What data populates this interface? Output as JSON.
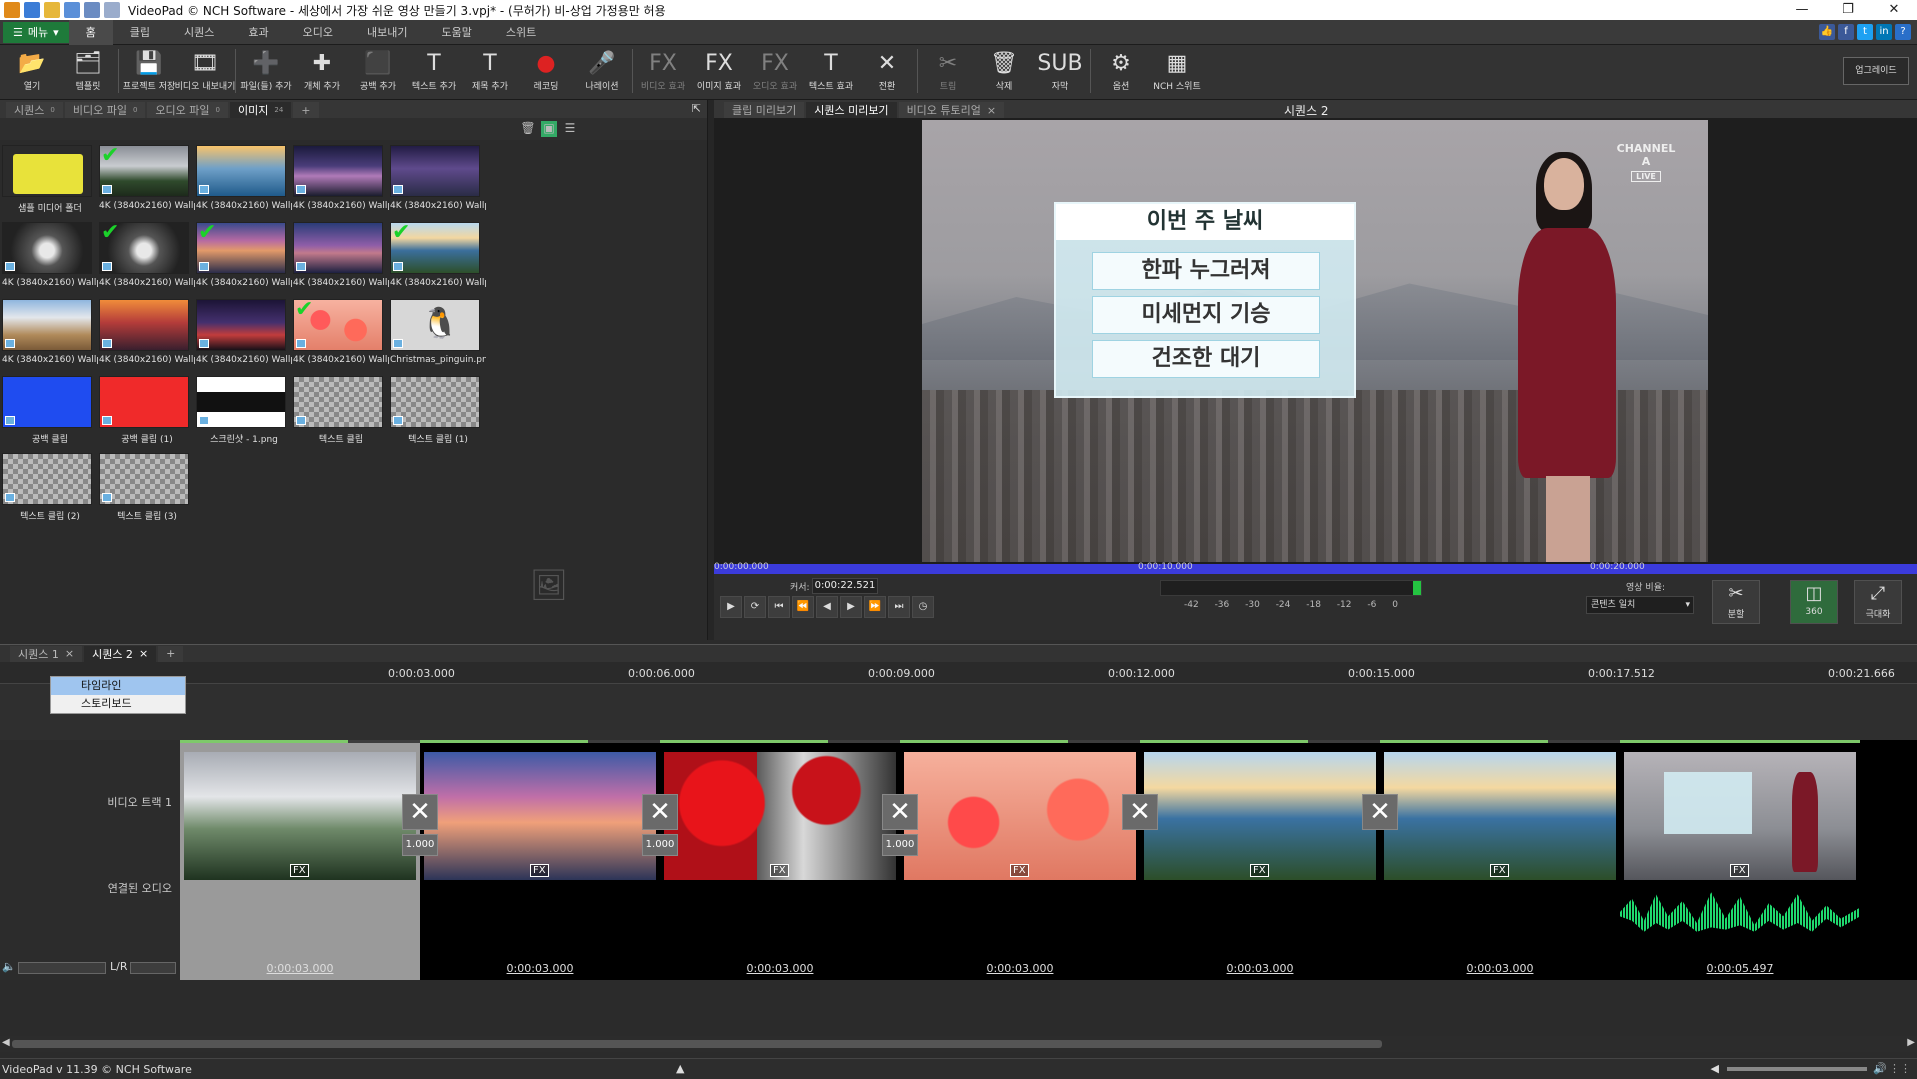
{
  "window": {
    "title": "VideoPad © NCH Software - 세상에서 가장 쉬운 영상 만들기 3.vpj* - (무허가) 비-상업 가정용만 허용",
    "controls": [
      "—",
      "❐",
      "✕"
    ]
  },
  "menu": {
    "menu_button": "메뉴",
    "tabs": [
      "홈",
      "클립",
      "시퀀스",
      "효과",
      "오디오",
      "내보내기",
      "도움말",
      "스위트"
    ],
    "active_tab": "홈"
  },
  "ribbon": {
    "buttons": [
      {
        "label": "열기",
        "icon": "folder-open-icon",
        "glyph": "📂"
      },
      {
        "label": "템플릿",
        "icon": "template-icon",
        "glyph": "🗂"
      },
      {
        "label": "프로젝트 저장",
        "icon": "save-icon",
        "glyph": "💾"
      },
      {
        "label": "비디오 내보내기",
        "icon": "export-icon",
        "glyph": "🎞"
      },
      {
        "label": "파일(들) 추가",
        "icon": "add-files-icon",
        "glyph": "➕"
      },
      {
        "label": "개체 추가",
        "icon": "add-object-icon",
        "glyph": "✚"
      },
      {
        "label": "공백 추가",
        "icon": "add-blank-icon",
        "glyph": "⬛"
      },
      {
        "label": "텍스트 추가",
        "icon": "add-text-icon",
        "glyph": "T"
      },
      {
        "label": "제목 추가",
        "icon": "add-title-icon",
        "glyph": "T"
      },
      {
        "label": "레코딩",
        "icon": "record-icon",
        "glyph": "●"
      },
      {
        "label": "나레이션",
        "icon": "microphone-icon",
        "glyph": "🎤"
      },
      {
        "label": "비디오 효과",
        "icon": "video-effects-icon",
        "glyph": "FX",
        "dim": true
      },
      {
        "label": "이미지 효과",
        "icon": "image-effects-icon",
        "glyph": "FX"
      },
      {
        "label": "오디오 효과",
        "icon": "audio-effects-icon",
        "glyph": "FX",
        "dim": true
      },
      {
        "label": "텍스트 효과",
        "icon": "text-effects-icon",
        "glyph": "T"
      },
      {
        "label": "전환",
        "icon": "transition-icon",
        "glyph": "✕"
      },
      {
        "label": "트림",
        "icon": "trim-icon",
        "glyph": "✂",
        "dim": true
      },
      {
        "label": "삭제",
        "icon": "trash-icon",
        "glyph": "🗑"
      },
      {
        "label": "자막",
        "icon": "subtitle-icon",
        "glyph": "SUB"
      },
      {
        "label": "옵션",
        "icon": "options-icon",
        "glyph": "⚙"
      },
      {
        "label": "NCH 스위트",
        "icon": "nch-suite-icon",
        "glyph": "▦"
      }
    ],
    "upgrade": "업그레이드"
  },
  "bin": {
    "tabs": [
      {
        "label": "시퀀스",
        "count": "0"
      },
      {
        "label": "비디오 파일",
        "count": "0"
      },
      {
        "label": "오디오 파일",
        "count": "0"
      },
      {
        "label": "이미지",
        "count": "24"
      }
    ],
    "add_tab": "+",
    "items": [
      {
        "label": "샘플 미디어 폴더",
        "kind": "folder",
        "checked": false
      },
      {
        "label": "4K (3840x2160) Wallp...",
        "kind": "steam",
        "checked": true
      },
      {
        "label": "4K (3840x2160) Wallp...",
        "kind": "rock",
        "checked": false
      },
      {
        "label": "4K (3840x2160) Wallp...",
        "kind": "galaxy",
        "checked": false
      },
      {
        "label": "4K (3840x2160) Wallp...",
        "kind": "galaxy2",
        "checked": false
      },
      {
        "label": "4K (3840x2160) Wallp...",
        "kind": "bw",
        "checked": false
      },
      {
        "label": "4K (3840x2160) Wallp...",
        "kind": "bw",
        "checked": true
      },
      {
        "label": "4K (3840x2160) Wallp...",
        "kind": "sunset",
        "checked": true
      },
      {
        "label": "4K (3840x2160) Wallp...",
        "kind": "sunset2",
        "checked": false
      },
      {
        "label": "4K (3840x2160) Wallp...",
        "kind": "coast",
        "checked": true
      },
      {
        "label": "4K (3840x2160) Wallp...",
        "kind": "mountain",
        "checked": false
      },
      {
        "label": "4K (3840x2160) Wallp...",
        "kind": "tree",
        "checked": false
      },
      {
        "label": "4K (3840x2160) Wallp...",
        "kind": "road",
        "checked": false
      },
      {
        "label": "4K (3840x2160) Wallp...",
        "kind": "poppy",
        "checked": true
      },
      {
        "label": "Christmas_pinguin.png",
        "kind": "penguin",
        "checked": false
      },
      {
        "label": "공백 클립",
        "kind": "blue",
        "checked": false
      },
      {
        "label": "공백 클립 (1)",
        "kind": "red",
        "checked": false
      },
      {
        "label": "스크린샷 - 1.png",
        "kind": "screenshot",
        "checked": false
      },
      {
        "label": "텍스트 클립",
        "kind": "checker",
        "checked": false
      },
      {
        "label": "텍스트 클립 (1)",
        "kind": "checker",
        "checked": false
      },
      {
        "label": "텍스트 클립 (2)",
        "kind": "checker",
        "checked": false
      },
      {
        "label": "텍스트 클립 (3)",
        "kind": "checker",
        "checked": false
      }
    ]
  },
  "preview": {
    "tabs": [
      {
        "label": "클립 미리보기"
      },
      {
        "label": "시퀀스 미리보기"
      },
      {
        "label": "비디오 튜토리얼",
        "closable": true
      }
    ],
    "sequence_name": "시퀀스 2",
    "video": {
      "board_title": "이번 주 날씨",
      "board_lines": [
        "한파 누그러져",
        "미세먼지 기승",
        "건조한 대기"
      ],
      "logo": "CHANNEL A",
      "logo_live": "LIVE"
    },
    "timebar": [
      "0:00:00.000",
      "0:00:10.000",
      "0:00:20.000"
    ],
    "cursor_label": "커서:",
    "cursor_time": "0:00:22.521",
    "meter_scale": [
      "-42",
      "-36",
      "-30",
      "-24",
      "-18",
      "-12",
      "-6",
      "0"
    ],
    "ratio_label": "영상 비율:",
    "ratio_value": "콘텐츠 일치",
    "split_label": "분할",
    "vr_label": "360",
    "fullscreen_label": "극대화"
  },
  "timeline": {
    "sequence_tabs": [
      {
        "label": "시퀀스 1"
      },
      {
        "label": "시퀀스 2"
      }
    ],
    "add_tab": "+",
    "context_menu": [
      "타임라인",
      "스토리보드"
    ],
    "ruler": [
      "0:00:03.000",
      "0:00:06.000",
      "0:00:09.000",
      "0:00:12.000",
      "0:00:15.000",
      "0:00:17.512",
      "0:00:21.666"
    ],
    "video_track_label": "비디오 트랙 1",
    "audio_track_label": "연결된 오디오",
    "lr_label": "L/R",
    "clips": [
      {
        "kind": "steam",
        "duration": "0:00:03.000",
        "fx": "FX"
      },
      {
        "kind": "sunset",
        "duration": "0:00:03.000",
        "fx": "FX"
      },
      {
        "kind": "redbw",
        "duration": "0:00:03.000",
        "fx": "FX"
      },
      {
        "kind": "poppy",
        "duration": "0:00:03.000",
        "fx": "FX"
      },
      {
        "kind": "coast",
        "duration": "0:00:03.000",
        "fx": "FX"
      },
      {
        "kind": "coast",
        "duration": "0:00:03.000",
        "fx": "FX"
      },
      {
        "kind": "news",
        "duration": "0:00:05.497",
        "fx": "FX"
      }
    ],
    "transitions": [
      {
        "value": "1.000"
      },
      {
        "value": "1.000"
      },
      {
        "value": "1.000"
      },
      {
        "value": ""
      },
      {
        "value": ""
      }
    ]
  },
  "status": {
    "version": "VideoPad v 11.39 © NCH Software"
  }
}
